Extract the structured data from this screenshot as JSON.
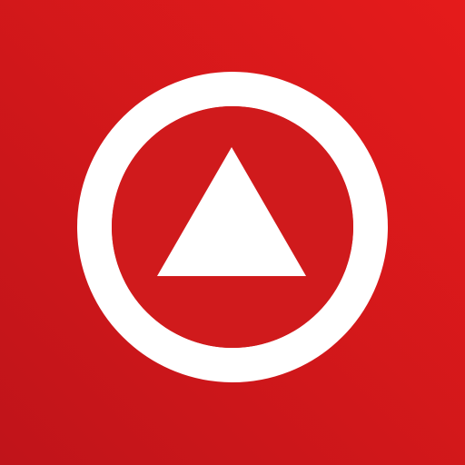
{
  "icon": {
    "semantic": "up-triangle-in-ring-icon",
    "colors": {
      "background_top_right": "#e51b1b",
      "background_bottom_left": "#c0141a",
      "ring": "#ffffff",
      "ring_interior": "#d01a1c",
      "triangle": "#ffffff"
    }
  }
}
